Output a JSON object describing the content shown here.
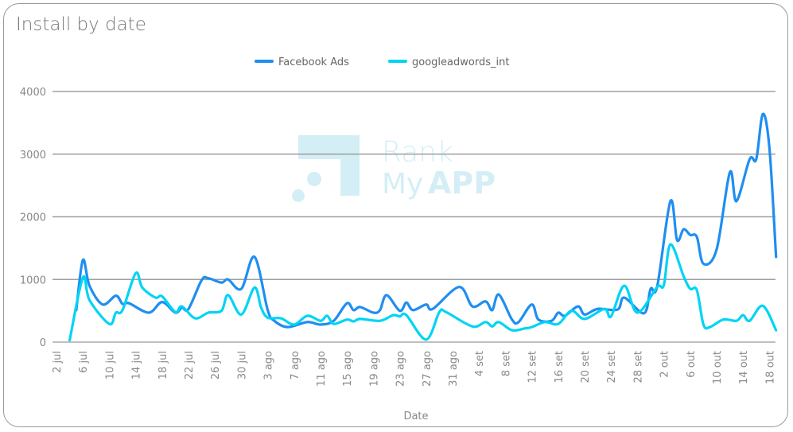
{
  "chart_data": {
    "type": "line",
    "title": "Install by date",
    "xlabel": "Date",
    "ylabel": "",
    "ylim": [
      0,
      4000
    ],
    "yticks": [
      0,
      1000,
      2000,
      3000,
      4000
    ],
    "xticks": [
      "2 jul",
      "6 jul",
      "10 jul",
      "14 jul",
      "18 jul",
      "22 jul",
      "26 jul",
      "30 jul",
      "3 ago",
      "7 ago",
      "11 ago",
      "15 ago",
      "19 ago",
      "23 ago",
      "27 ago",
      "31 ago",
      "4 set",
      "8 set",
      "12 set",
      "16 set",
      "20 set",
      "24 set",
      "28 set",
      "2 out",
      "6 out",
      "10 out",
      "14 out",
      "18 out"
    ],
    "grid": true,
    "legend_position": "top",
    "watermark": "Rank My APP",
    "series": [
      {
        "name": "Facebook Ads",
        "color": "#1f8ef1",
        "points": [
          [
            "5 jul",
            510
          ],
          [
            "6 jul",
            1310
          ],
          [
            "7 jul",
            900
          ],
          [
            "9 jul",
            600
          ],
          [
            "11 jul",
            740
          ],
          [
            "12 jul",
            610
          ],
          [
            "13 jul",
            620
          ],
          [
            "16 jul",
            470
          ],
          [
            "18 jul",
            640
          ],
          [
            "20 jul",
            470
          ],
          [
            "21 jul",
            550
          ],
          [
            "22 jul",
            530
          ],
          [
            "24 jul",
            990
          ],
          [
            "25 jul",
            1020
          ],
          [
            "27 jul",
            950
          ],
          [
            "28 jul",
            1000
          ],
          [
            "30 jul",
            850
          ],
          [
            "1 ago",
            1360
          ],
          [
            "3 ago",
            510
          ],
          [
            "4 ago",
            340
          ],
          [
            "6 ago",
            240
          ],
          [
            "9 ago",
            320
          ],
          [
            "11 ago",
            280
          ],
          [
            "13 ago",
            340
          ],
          [
            "15 ago",
            620
          ],
          [
            "16 ago",
            510
          ],
          [
            "17 ago",
            560
          ],
          [
            "19 ago",
            470
          ],
          [
            "20 ago",
            510
          ],
          [
            "21 ago",
            750
          ],
          [
            "23 ago",
            500
          ],
          [
            "24 ago",
            630
          ],
          [
            "25 ago",
            510
          ],
          [
            "27 ago",
            600
          ],
          [
            "28 ago",
            530
          ],
          [
            "1 set",
            880
          ],
          [
            "3 set",
            570
          ],
          [
            "5 set",
            650
          ],
          [
            "6 set",
            510
          ],
          [
            "7 set",
            760
          ],
          [
            "9 set",
            360
          ],
          [
            "10 set",
            320
          ],
          [
            "12 set",
            600
          ],
          [
            "13 set",
            360
          ],
          [
            "15 set",
            340
          ],
          [
            "16 set",
            470
          ],
          [
            "17 set",
            420
          ],
          [
            "19 set",
            570
          ],
          [
            "20 set",
            440
          ],
          [
            "22 set",
            530
          ],
          [
            "25 set",
            520
          ],
          [
            "26 set",
            710
          ],
          [
            "29 set",
            460
          ],
          [
            "30 set",
            850
          ],
          [
            "1 out",
            890
          ],
          [
            "3 out",
            2250
          ],
          [
            "4 out",
            1630
          ],
          [
            "5 out",
            1800
          ],
          [
            "6 out",
            1710
          ],
          [
            "7 out",
            1680
          ],
          [
            "8 out",
            1250
          ],
          [
            "10 out",
            1480
          ],
          [
            "12 out",
            2710
          ],
          [
            "13 out",
            2250
          ],
          [
            "15 out",
            2920
          ],
          [
            "16 out",
            2920
          ],
          [
            "17 out",
            3640
          ],
          [
            "18 out",
            3090
          ],
          [
            "19 out",
            1360
          ]
        ]
      },
      {
        "name": "googleadwords_int",
        "color": "#00d4f5",
        "points": [
          [
            "4 jul",
            30
          ],
          [
            "6 jul",
            1030
          ],
          [
            "7 jul",
            670
          ],
          [
            "10 jul",
            290
          ],
          [
            "11 jul",
            470
          ],
          [
            "12 jul",
            510
          ],
          [
            "14 jul",
            1100
          ],
          [
            "15 jul",
            870
          ],
          [
            "17 jul",
            710
          ],
          [
            "18 jul",
            730
          ],
          [
            "20 jul",
            480
          ],
          [
            "21 jul",
            570
          ],
          [
            "23 jul",
            380
          ],
          [
            "25 jul",
            470
          ],
          [
            "27 jul",
            500
          ],
          [
            "28 jul",
            750
          ],
          [
            "30 jul",
            440
          ],
          [
            "1 ago",
            870
          ],
          [
            "2 ago",
            550
          ],
          [
            "3 ago",
            390
          ],
          [
            "5 ago",
            380
          ],
          [
            "7 ago",
            280
          ],
          [
            "9 ago",
            420
          ],
          [
            "11 ago",
            340
          ],
          [
            "12 ago",
            420
          ],
          [
            "13 ago",
            290
          ],
          [
            "15 ago",
            360
          ],
          [
            "16 ago",
            330
          ],
          [
            "17 ago",
            370
          ],
          [
            "20 ago",
            340
          ],
          [
            "22 ago",
            430
          ],
          [
            "23 ago",
            410
          ],
          [
            "24 ago",
            430
          ],
          [
            "27 ago",
            40
          ],
          [
            "29 ago",
            480
          ],
          [
            "30 ago",
            480
          ],
          [
            "3 set",
            250
          ],
          [
            "5 set",
            320
          ],
          [
            "6 set",
            250
          ],
          [
            "7 set",
            320
          ],
          [
            "9 set",
            190
          ],
          [
            "11 set",
            220
          ],
          [
            "12 set",
            240
          ],
          [
            "14 set",
            320
          ],
          [
            "16 set",
            290
          ],
          [
            "18 set",
            500
          ],
          [
            "20 set",
            370
          ],
          [
            "23 set",
            530
          ],
          [
            "24 set",
            410
          ],
          [
            "26 set",
            900
          ],
          [
            "28 set",
            470
          ],
          [
            "1 out",
            880
          ],
          [
            "2 out",
            910
          ],
          [
            "3 out",
            1560
          ],
          [
            "5 out",
            1050
          ],
          [
            "6 out",
            850
          ],
          [
            "7 out",
            830
          ],
          [
            "8 out",
            280
          ],
          [
            "9 out",
            240
          ],
          [
            "11 out",
            360
          ],
          [
            "13 out",
            340
          ],
          [
            "14 out",
            430
          ],
          [
            "15 out",
            340
          ],
          [
            "17 out",
            580
          ],
          [
            "19 out",
            190
          ]
        ]
      }
    ]
  }
}
